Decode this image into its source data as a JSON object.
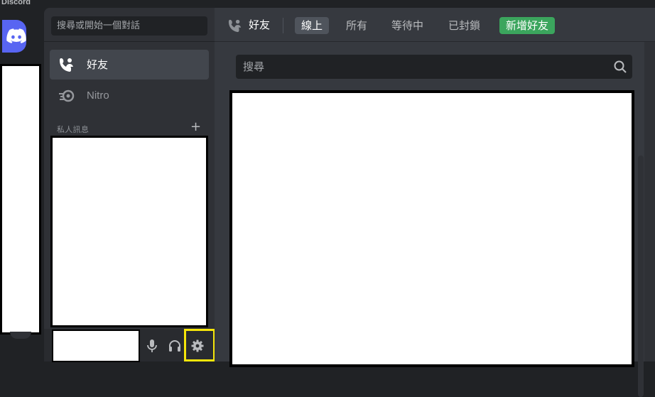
{
  "app": {
    "title": "Discord"
  },
  "sidebar": {
    "search_placeholder": "搜尋或開始一個對話",
    "nav": [
      {
        "label": "好友",
        "icon": "friends-icon",
        "active": true
      },
      {
        "label": "Nitro",
        "icon": "nitro-icon",
        "active": false
      }
    ],
    "dm_header": "私人訊息",
    "dm_add": "+"
  },
  "user_panel": {
    "buttons": [
      {
        "name": "mute-button",
        "icon": "microphone-icon"
      },
      {
        "name": "deafen-button",
        "icon": "headphones-icon"
      },
      {
        "name": "user-settings-button",
        "icon": "gear-icon"
      }
    ]
  },
  "topbar": {
    "title": "好友",
    "tabs": [
      {
        "label": "線上",
        "selected": true
      },
      {
        "label": "所有",
        "selected": false
      },
      {
        "label": "等待中",
        "selected": false
      },
      {
        "label": "已封鎖",
        "selected": false
      }
    ],
    "add_friend": "新增好友"
  },
  "main": {
    "search_placeholder": "搜尋"
  },
  "colors": {
    "brand": "#5865f2",
    "add_friend": "#3ba55d",
    "highlight": "#f5e50a"
  }
}
